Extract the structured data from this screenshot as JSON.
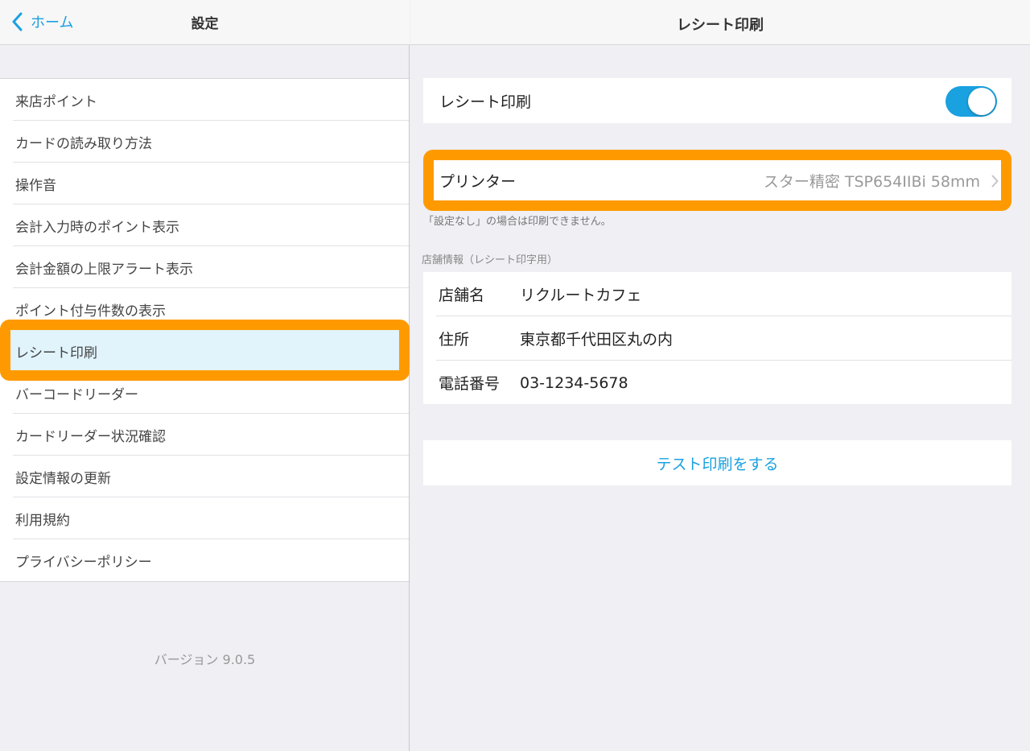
{
  "left": {
    "back_label": "ホーム",
    "title": "設定",
    "menu": [
      {
        "label": "来店ポイント"
      },
      {
        "label": "カードの読み取り方法"
      },
      {
        "label": "操作音"
      },
      {
        "label": "会計入力時のポイント表示"
      },
      {
        "label": "会計金額の上限アラート表示"
      },
      {
        "label": "ポイント付与件数の表示"
      },
      {
        "label": "レシート印刷"
      },
      {
        "label": "バーコードリーダー"
      },
      {
        "label": "カードリーダー状況確認"
      },
      {
        "label": "設定情報の更新"
      },
      {
        "label": "利用規約"
      },
      {
        "label": "プライバシーポリシー"
      }
    ],
    "version": "バージョン 9.0.5"
  },
  "right": {
    "title": "レシート印刷",
    "receipt_toggle_label": "レシート印刷",
    "receipt_toggle_on": true,
    "printer_label": "プリンター",
    "printer_value": "スター精密 TSP654IIBi 58mm",
    "printer_note": "「設定なし」の場合は印刷できません。",
    "store_section_label": "店舗情報（レシート印字用）",
    "store": {
      "name_label": "店舗名",
      "name_value": "リクルートカフェ",
      "address_label": "住所",
      "address_value": "東京都千代田区丸の内",
      "phone_label": "電話番号",
      "phone_value": "03-1234-5678"
    },
    "test_print_label": "テスト印刷をする"
  },
  "colors": {
    "accent": "#1aa1e0",
    "highlight": "#fe9a00",
    "selected_bg": "#e1f3fb"
  }
}
